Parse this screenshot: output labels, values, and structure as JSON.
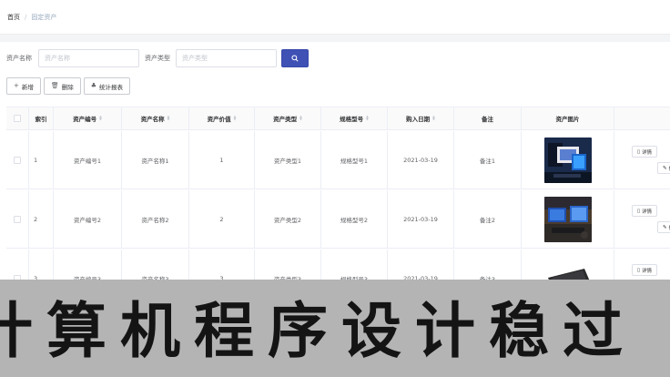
{
  "breadcrumb": {
    "home": "首页",
    "separator": "/",
    "current": "固定资产"
  },
  "search": {
    "name_label": "资产名称",
    "name_placeholder": "资产名称",
    "type_label": "资产类型",
    "type_placeholder": "资产类型",
    "search_icon": "search-icon"
  },
  "toolbar": {
    "add_icon": "+",
    "add": "新增",
    "delete_icon": "🗑",
    "delete": "删除",
    "report_icon": "♣",
    "report": "统计报表"
  },
  "table": {
    "headers": {
      "index": "索引",
      "code": "资产编号",
      "name": "资产名称",
      "value": "资产价值",
      "type": "资产类型",
      "model": "规格型号",
      "date": "购入日期",
      "remark": "备注",
      "image": "资产图片"
    },
    "rows": [
      {
        "index": "1",
        "code": "资产编号1",
        "name": "资产名称1",
        "value": "1",
        "type": "资产类型1",
        "model": "规格型号1",
        "date": "2021-03-19",
        "remark": "备注1"
      },
      {
        "index": "2",
        "code": "资产编号2",
        "name": "资产名称2",
        "value": "2",
        "type": "资产类型2",
        "model": "规格型号2",
        "date": "2021-03-19",
        "remark": "备注2"
      },
      {
        "index": "3",
        "code": "资产编号3",
        "name": "资产名称3",
        "value": "3",
        "type": "资产类型3",
        "model": "规格型号3",
        "date": "2021-03-19",
        "remark": "备注3"
      }
    ],
    "actions": {
      "detail_icon": "▯",
      "detail": "详情",
      "edit_icon": "✎",
      "edit": "修"
    }
  },
  "banner": {
    "text": "计算机程序设计稳过"
  },
  "colors": {
    "primary": "#3f51b5",
    "border": "#ebeef5",
    "banner_bg": "#b4b4b4"
  }
}
